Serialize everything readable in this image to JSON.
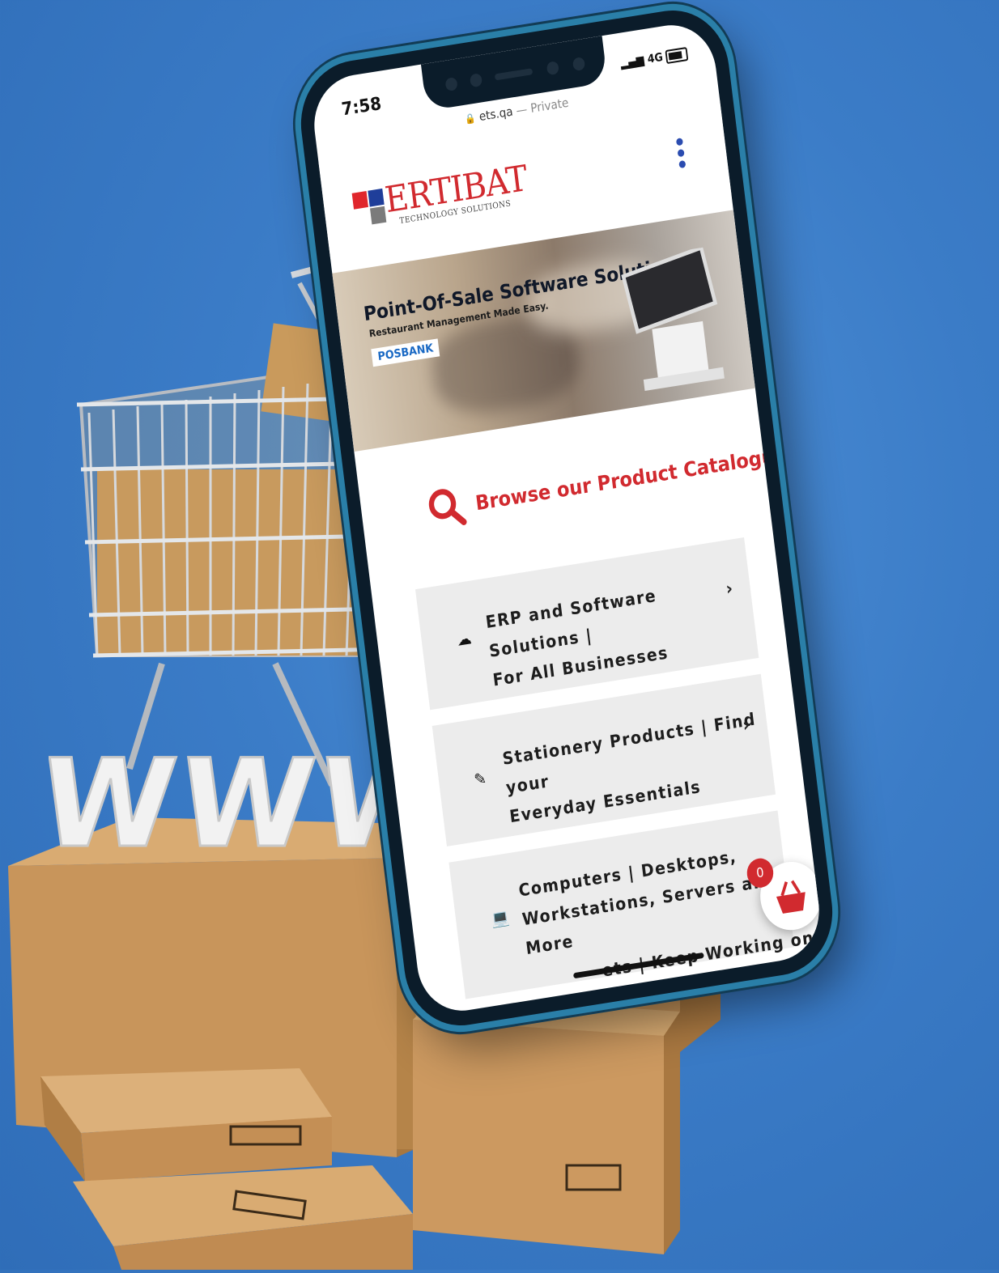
{
  "phone": {
    "status": {
      "time": "7:58",
      "signal": "4G"
    },
    "browser": {
      "url": "ets.qa",
      "mode": "Private"
    },
    "logo": {
      "name": "ERTIBAT",
      "tagline": "TECHNOLOGY SOLUTIONS"
    },
    "banner": {
      "title": "Point-Of-Sale Software Solution",
      "subtitle": "Restaurant Management Made Easy.",
      "brand": "POSBANK"
    },
    "catalogue": {
      "heading": "Browse our Product Catalogue",
      "categories": [
        {
          "line1": "ERP and Software Solutions |",
          "line2": "For All Businesses",
          "line3": "",
          "icon": "cloud-upload-icon"
        },
        {
          "line1": "Stationery Products | Find your",
          "line2": "Everyday Essentials",
          "line3": "",
          "icon": "pencil-icon"
        },
        {
          "line1": "Computers | Desktops,",
          "line2": "Workstations, Servers and",
          "line3": "More",
          "icon": "laptop-icon"
        }
      ],
      "partial_row": "ets | Keep Working on the"
    },
    "cart_count": "0"
  },
  "scene": {
    "letters": "WWW"
  },
  "colors": {
    "accent": "#d12a2f",
    "background": "#3b7cc7",
    "frame": "#2a7fa8"
  }
}
